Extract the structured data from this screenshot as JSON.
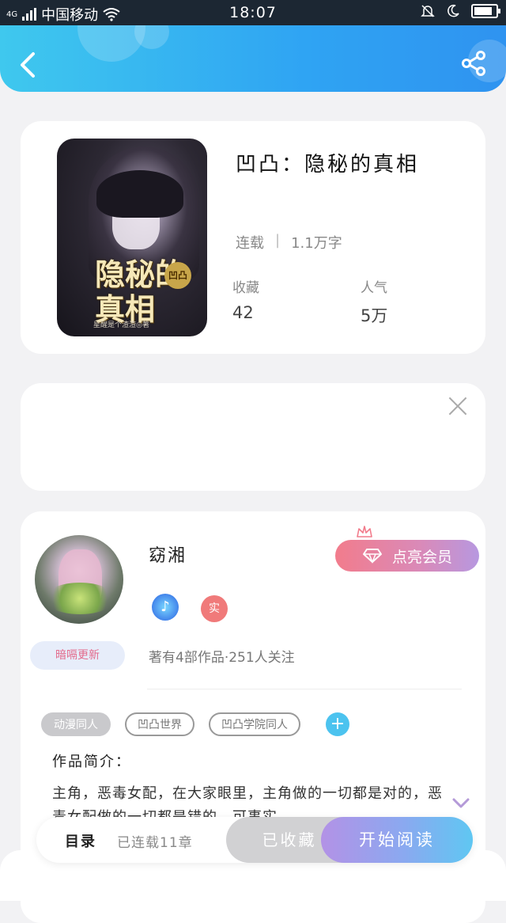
{
  "status_bar": {
    "network": "4G",
    "carrier": "中国移动",
    "time": "18:07"
  },
  "header": {
    "back_icon": "chevron-left-icon",
    "share_icon": "share-icon"
  },
  "book": {
    "title": "凹凸：隐秘的真相",
    "status": "连载",
    "word_count": "1.1万字",
    "favorites_label": "收藏",
    "favorites_value": "42",
    "popularity_label": "人气",
    "popularity_value": "5万",
    "cover_title": "隐秘的真相",
    "cover_badge": "凹凸",
    "cover_author": "星醒是个渣渣◎著"
  },
  "ad": {
    "close_icon": "close-icon"
  },
  "author": {
    "name": "窈湘",
    "tag": "暗嗝更新",
    "vip_button": "点亮会员",
    "badge_music": "♪",
    "badge_real": "实",
    "stats": "著有4部作品·251人关注"
  },
  "tags": [
    {
      "label": "动漫同人",
      "filled": true
    },
    {
      "label": "凹凸世界",
      "filled": false
    },
    {
      "label": "凹凸学院同人",
      "filled": false
    }
  ],
  "intro": {
    "label": "作品简介：",
    "text": "主角，恶毒女配，在大家眼里，主角做的一切都是对的，恶毒女配做的一切都是错的，可事实……"
  },
  "bottom_bar": {
    "toc_label": "目录",
    "toc_status": "已连载11章",
    "fav_button": "已收藏",
    "read_button": "开始阅读"
  },
  "colors": {
    "header_start": "#3fc8ee",
    "header_end": "#2f93f0",
    "vip_start": "#f27c8c",
    "vip_end": "#b798e0",
    "read_start": "#b392e6",
    "read_end": "#5fc7f2",
    "tag_add": "#4cc3ef"
  }
}
